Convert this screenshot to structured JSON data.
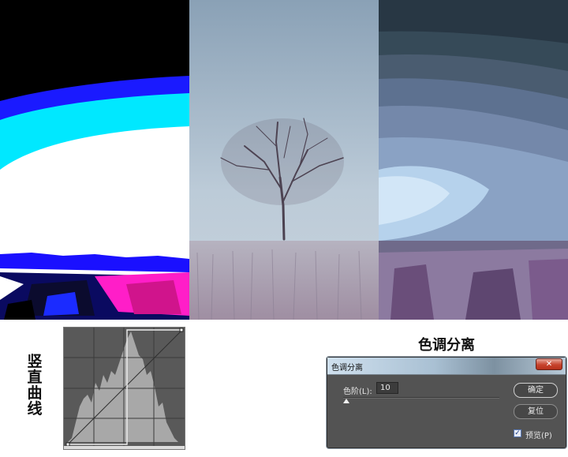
{
  "captions": {
    "curve": "竖直曲线",
    "posterize": "色调分离"
  },
  "dialog": {
    "title": "色调分离",
    "close_icon": "close-icon",
    "levels_label": "色阶(L):",
    "levels_value": "10",
    "slider_level": 0.0,
    "ok_label": "确定",
    "reset_label": "复位",
    "preview_label": "预览(P)",
    "preview_checked": true,
    "accent_close": "#c7432c",
    "background": "#535353"
  },
  "panels": [
    {
      "name": "curve-result",
      "description_colors": [
        "#000000",
        "#0a14ff",
        "#00f0ff",
        "#ffffff",
        "#ff20c0"
      ]
    },
    {
      "name": "original-photo",
      "description_colors": [
        "#9db1c6",
        "#c3d0dc",
        "#a89aa8"
      ]
    },
    {
      "name": "posterize-result",
      "description_colors": [
        "#2e3f4f",
        "#7a8fb3",
        "#a9c1df",
        "#7a5b8a"
      ]
    }
  ]
}
